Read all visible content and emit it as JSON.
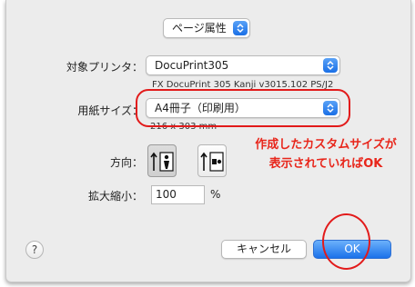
{
  "dialog": {
    "section_popup": "ページ属性",
    "target_printer": {
      "label": "対象プリンタ：",
      "value": "DocuPrint305",
      "description": "FX DocuPrint 305 Kanji v3015.102 PS/J2"
    },
    "paper_size": {
      "label": "用紙サイズ：",
      "value": "A4冊子（印刷用）",
      "dimensions": "216 x 303 mm"
    },
    "orientation": {
      "label": "方向："
    },
    "scale": {
      "label": "拡大縮小：",
      "value": "100",
      "unit": "%"
    },
    "help_label": "?",
    "cancel_label": "キャンセル",
    "ok_label": "OK"
  },
  "annotation": {
    "line1": "作成したカスタムサイズが",
    "line2": "表示されていればOK",
    "color": "#e8261b"
  }
}
